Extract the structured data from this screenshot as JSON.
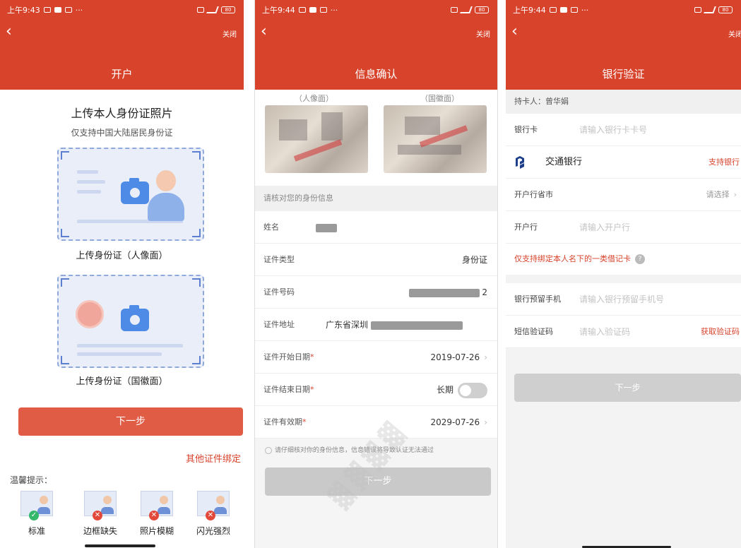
{
  "status": {
    "p1_time": "上午9:43",
    "p2_time": "上午9:44",
    "p3_time": "上午9:44",
    "battery": "80"
  },
  "screen1": {
    "title": "开户",
    "close": "关闭",
    "heading": "上传本人身份证照片",
    "subheading": "仅支持中国大陆居民身份证",
    "front_label": "上传身份证（人像面）",
    "back_label": "上传身份证（国徽面）",
    "next": "下一步",
    "other_binding": "其他证件绑定",
    "tips_title": "温馨提示：",
    "tips": [
      {
        "label": "标准",
        "status": "ok"
      },
      {
        "label": "边框缺失",
        "status": "bad"
      },
      {
        "label": "照片模糊",
        "status": "bad"
      },
      {
        "label": "闪光强烈",
        "status": "bad"
      }
    ]
  },
  "screen2": {
    "title": "信息确认",
    "close": "关闭",
    "front_caption": "（人像面）",
    "back_caption": "（国徽面）",
    "section": "请核对您的身份信息",
    "name_label": "姓名",
    "type_label": "证件类型",
    "type_value": "身份证",
    "id_label": "证件号码",
    "id_tail": "2",
    "addr_label": "证件地址",
    "addr_value": "广东省深圳",
    "start_label": "证件开始日期",
    "start_value": "2019-07-26",
    "end_label": "证件结束日期",
    "end_value": "长期",
    "valid_label": "证件有效期",
    "valid_value": "2029-07-26",
    "notice": "请仔细核对你的身份信息，信息错误将导致认证无法通过",
    "next": "下一步",
    "required_mark": "*"
  },
  "screen3": {
    "title": "银行验证",
    "close": "关闭",
    "holder": "持卡人：曾华娟",
    "card_label": "银行卡",
    "card_placeholder": "请输入银行卡卡号",
    "bank_name": "交通银行",
    "support_link": "支持银行",
    "province_label": "开户行省市",
    "province_value": "请选择",
    "branch_label": "开户行",
    "branch_placeholder": "请输入开户行",
    "limit_note": "仅支持绑定本人名下的一类借记卡",
    "phone_label": "银行预留手机",
    "phone_placeholder": "请输入银行预留手机号",
    "sms_label": "短信验证码",
    "sms_placeholder": "请输入验证码",
    "sms_button": "获取验证码",
    "next": "下一步"
  },
  "colors": {
    "brand_red": "#d8432c",
    "button_red": "#e05c44",
    "disabled_gray": "#c9c9c9"
  }
}
